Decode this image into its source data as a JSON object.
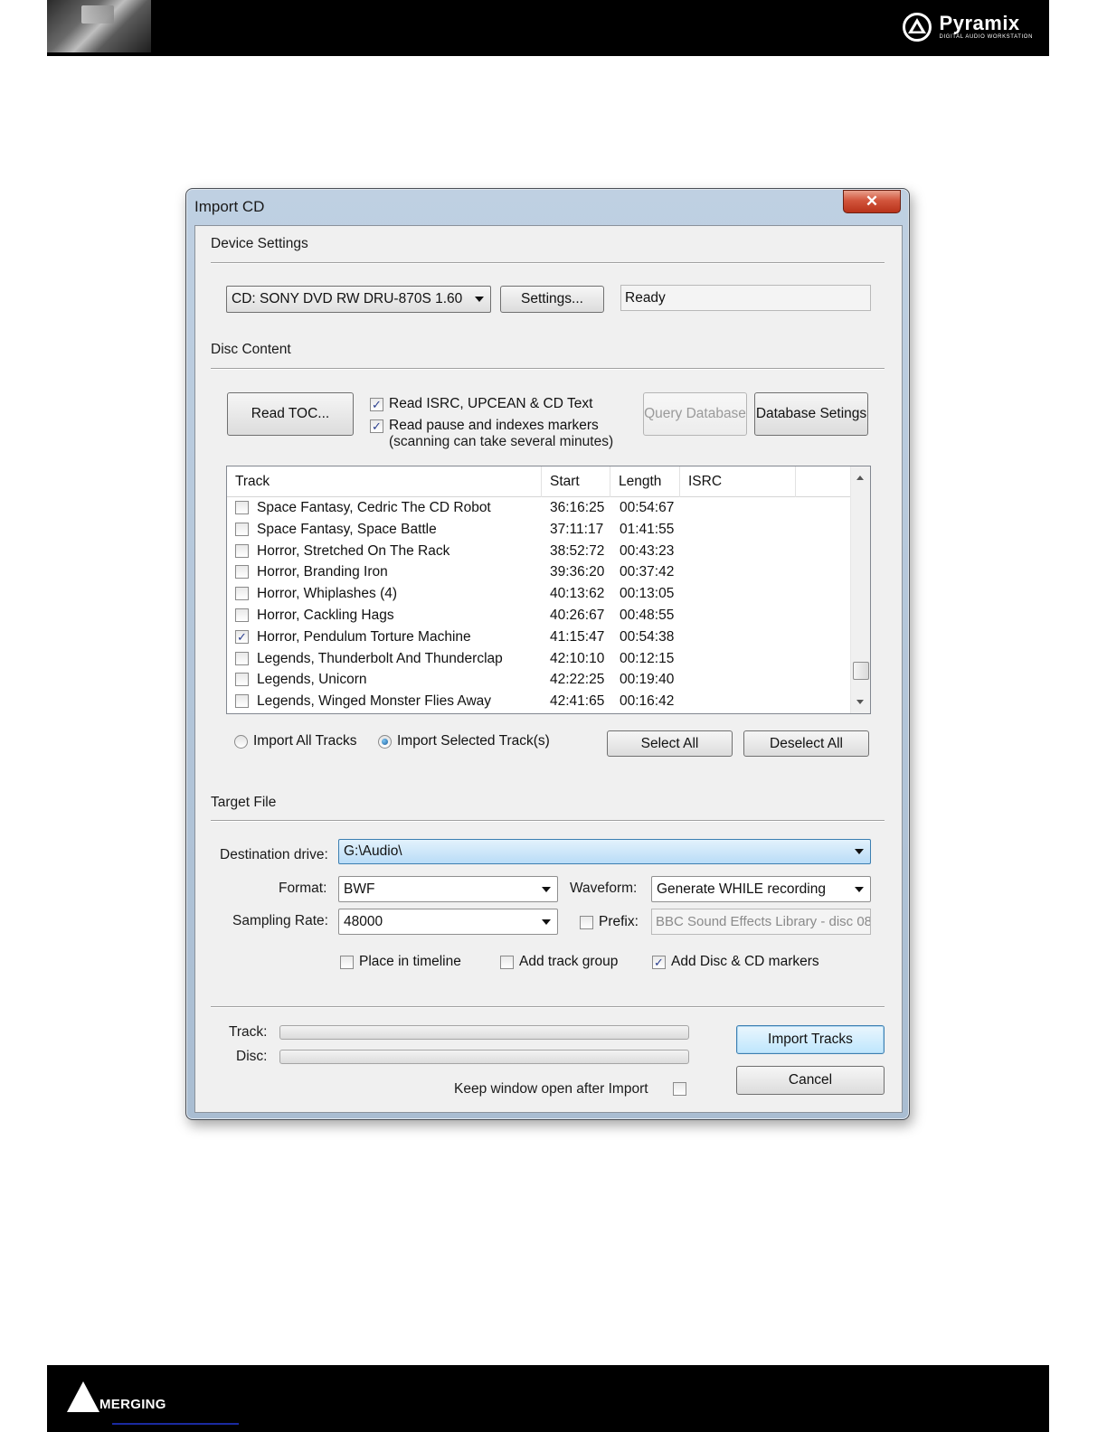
{
  "header": {
    "brand_name": "Pyramix",
    "brand_tagline": "DIGITAL AUDIO WORKSTATION"
  },
  "footer": {
    "brand_name": "MERGING"
  },
  "dialog": {
    "title": "Import CD",
    "close_icon": "close-icon",
    "device_settings": {
      "section_title": "Device Settings",
      "device_value": "CD: SONY DVD RW DRU-870S 1.60",
      "settings_button": "Settings...",
      "status": "Ready"
    },
    "disc_content": {
      "section_title": "Disc Content",
      "read_toc_button": "Read TOC...",
      "read_isrc_label": "Read ISRC, UPCEAN & CD Text",
      "read_isrc_checked": true,
      "read_pause_label": "Read pause and indexes markers",
      "read_pause_checked": true,
      "read_pause_note": "(scanning can take several minutes)",
      "query_database_button": "Query Database",
      "database_settings_button": "Database Setings"
    },
    "track_list": {
      "columns": [
        "Track",
        "Start",
        "Length",
        "ISRC"
      ],
      "rows": [
        {
          "title": "Space Fantasy, Cedric The CD Robot",
          "start": "36:16:25",
          "length": "00:54:67",
          "checked": false
        },
        {
          "title": "Space Fantasy, Space Battle",
          "start": "37:11:17",
          "length": "01:41:55",
          "checked": false
        },
        {
          "title": "Horror, Stretched On The Rack",
          "start": "38:52:72",
          "length": "00:43:23",
          "checked": false
        },
        {
          "title": "Horror, Branding Iron",
          "start": "39:36:20",
          "length": "00:37:42",
          "checked": false
        },
        {
          "title": "Horror, Whiplashes (4)",
          "start": "40:13:62",
          "length": "00:13:05",
          "checked": false
        },
        {
          "title": "Horror, Cackling Hags",
          "start": "40:26:67",
          "length": "00:48:55",
          "checked": false
        },
        {
          "title": "Horror, Pendulum Torture Machine",
          "start": "41:15:47",
          "length": "00:54:38",
          "checked": true
        },
        {
          "title": "Legends, Thunderbolt And Thunderclap",
          "start": "42:10:10",
          "length": "00:12:15",
          "checked": false
        },
        {
          "title": "Legends, Unicorn",
          "start": "42:22:25",
          "length": "00:19:40",
          "checked": false
        },
        {
          "title": "Legends, Winged Monster Flies Away",
          "start": "42:41:65",
          "length": "00:16:42",
          "checked": false
        }
      ]
    },
    "selection": {
      "import_all_label": "Import All Tracks",
      "import_selected_label": "Import Selected Track(s)",
      "selected_option": "Import Selected Track(s)",
      "select_all_button": "Select All",
      "deselect_all_button": "Deselect All"
    },
    "target_file": {
      "section_title": "Target File",
      "destination_label": "Destination drive:",
      "destination_value": "G:\\Audio\\",
      "format_label": "Format:",
      "format_value": "BWF",
      "waveform_label": "Waveform:",
      "waveform_value": "Generate WHILE recording",
      "sampling_label": "Sampling Rate:",
      "sampling_value": "48000",
      "prefix_label": "Prefix:",
      "prefix_checked": false,
      "prefix_value": "BBC Sound Effects Library - disc 08",
      "place_in_timeline_label": "Place in timeline",
      "place_in_timeline_checked": false,
      "add_track_group_label": "Add track group",
      "add_track_group_checked": false,
      "add_markers_label": "Add Disc & CD markers",
      "add_markers_checked": true
    },
    "progress": {
      "track_label": "Track:",
      "disc_label": "Disc:",
      "track_progress": 0,
      "disc_progress": 0
    },
    "footer_controls": {
      "import_tracks_button": "Import Tracks",
      "cancel_button": "Cancel",
      "keep_open_label": "Keep window open after Import",
      "keep_open_checked": false
    }
  }
}
